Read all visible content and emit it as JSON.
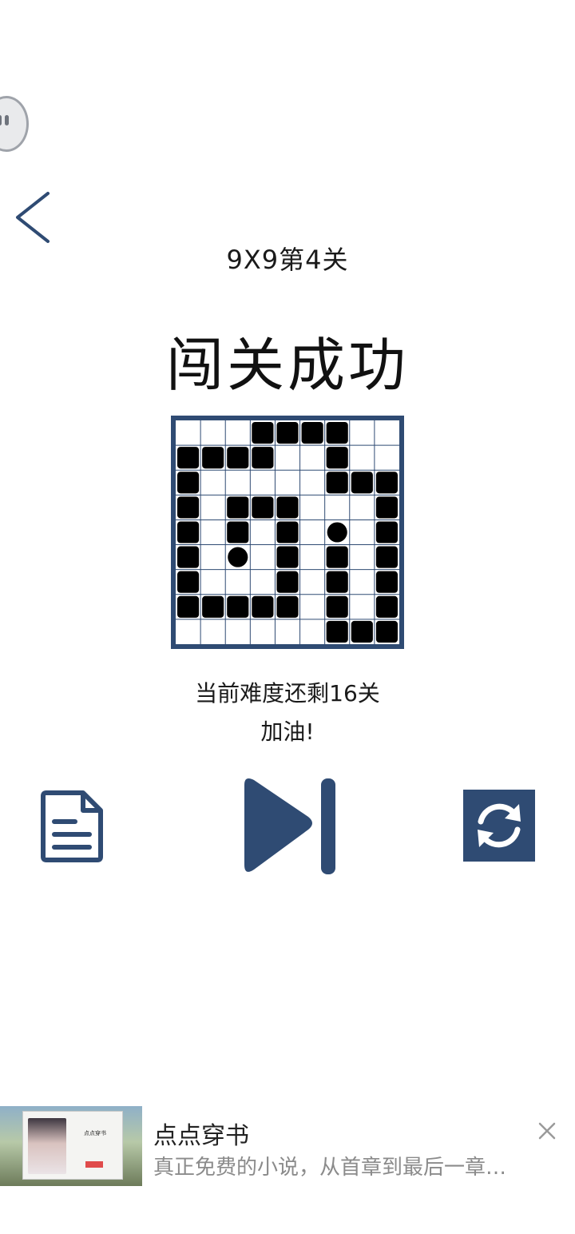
{
  "header": {
    "level_title": "9X9第4关"
  },
  "result": {
    "title": "闯关成功",
    "remaining_text": "当前难度还剩16关",
    "cheer_text": "加油!"
  },
  "board": {
    "size": 9,
    "grid": [
      "...XXXX..",
      "XXXX..X..",
      "X.....XXX",
      "X.XXX...X",
      "X.X.X.O.X",
      "X.O.X.X.X",
      "X...X.X.X",
      "XXXXX.X.X",
      "......XXX"
    ],
    "legend": {
      "X": "wall-block",
      "O": "ball",
      ".": "empty"
    },
    "colors": {
      "frame": "#2f4b73",
      "grid_line": "#2f4b73",
      "block": "#000000",
      "background": "#ffffff"
    }
  },
  "controls": {
    "accent_color": "#2f4b73",
    "icons": [
      "document-icon",
      "next-level-icon",
      "refresh-icon"
    ]
  },
  "ad": {
    "title": "点点穿书",
    "description": "真正免费的小说，从首章到最后一章…",
    "card_title": "点点穿书",
    "icons": [
      "ad-image",
      "close-icon"
    ]
  }
}
